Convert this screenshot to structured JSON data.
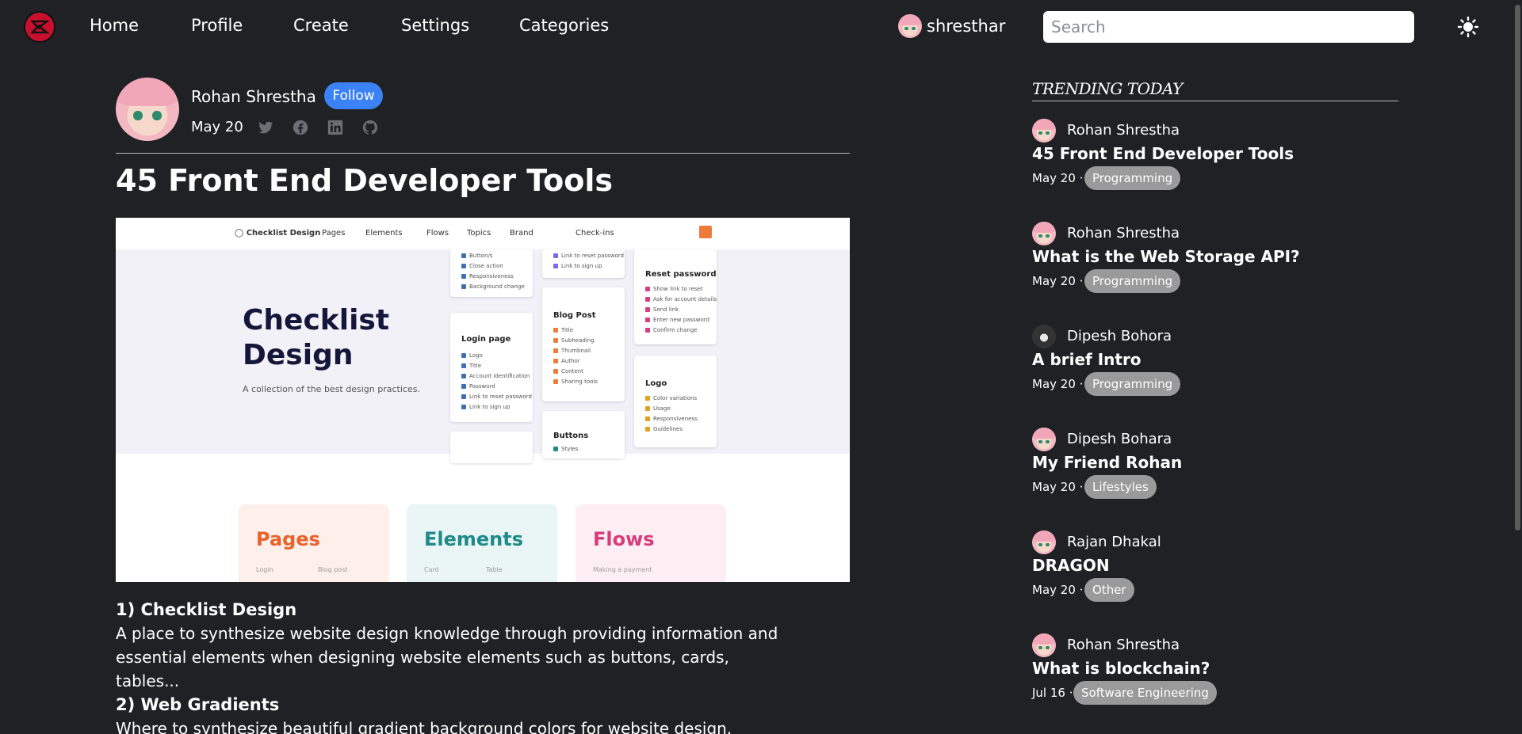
{
  "nav": {
    "links": [
      "Home",
      "Profile",
      "Create",
      "Settings",
      "Categories"
    ],
    "username": "shresthar",
    "search_placeholder": "Search"
  },
  "article": {
    "author": "Rohan Shrestha",
    "follow_label": "Follow",
    "date": "May 20",
    "title": "45 Front End Developer Tools",
    "hero": {
      "brand": "Checklist Design",
      "menu": [
        "Pages",
        "Elements",
        "Flows",
        "Topics",
        "Brand",
        "Check-ins"
      ],
      "headline": "Checklist Design",
      "subline": "A collection of the best design practices.",
      "cards": {
        "top_left": [
          "Button/s",
          "Close action",
          "Responsiveness",
          "Background change"
        ],
        "top_mid": [
          "Link to reset password",
          "Link to sign up"
        ],
        "login_title": "Login page",
        "login_items": [
          "Logo",
          "Title",
          "Account identification",
          "Password",
          "Link to reset password",
          "Link to sign up"
        ],
        "blog_title": "Blog Post",
        "blog_items": [
          "Title",
          "Subheading",
          "Thumbnail",
          "Author",
          "Content",
          "Sharing tools"
        ],
        "reset_title": "Reset password",
        "reset_items": [
          "Show link to reset",
          "Ask for account details",
          "Send link",
          "Enter new password",
          "Confirm change"
        ],
        "logo_title": "Logo",
        "logo_items": [
          "Color variations",
          "Usage",
          "Responsiveness",
          "Guidelines"
        ],
        "buttons_title": "Buttons",
        "buttons_items": [
          "Styles"
        ]
      },
      "big_cards": [
        {
          "title": "Pages",
          "a": "Login",
          "b": "Blog post",
          "color": "#e8622c",
          "bg": "#fdf0ea"
        },
        {
          "title": "Elements",
          "a": "Card",
          "b": "Table",
          "color": "#1f8a8a",
          "bg": "#eaf6f5"
        },
        {
          "title": "Flows",
          "a": "Making a payment",
          "b": "",
          "color": "#d63d7a",
          "bg": "#fdeef4"
        }
      ]
    },
    "sections": [
      {
        "heading": "1) Checklist Design",
        "body": "A place to synthesize website design knowledge through providing information and essential elements when designing website elements such as buttons, cards, tables..."
      },
      {
        "heading": "2) Web Gradients",
        "body": "Where to synthesize beautiful gradient background colors for website design."
      }
    ]
  },
  "sidebar": {
    "heading": "TRENDING TODAY",
    "items": [
      {
        "author": "Rohan Shrestha",
        "title": "45 Front End Developer Tools",
        "date": "May 20 ·",
        "tag": "Programming"
      },
      {
        "author": "Rohan Shrestha",
        "title": "What is the Web Storage API?",
        "date": "May 20 ·",
        "tag": "Programming"
      },
      {
        "author": "Dipesh Bohora",
        "title": "A brief Intro",
        "date": "May 20 ·",
        "tag": "Programming"
      },
      {
        "author": "Dipesh Bohara",
        "title": "My Friend Rohan",
        "date": "May 20 ·",
        "tag": "Lifestyles"
      },
      {
        "author": "Rajan Dhakal",
        "title": "DRAGON",
        "date": "May 20 ·",
        "tag": "Other"
      },
      {
        "author": "Rohan Shrestha",
        "title": "What is blockchain?",
        "date": "Jul 16 ·",
        "tag": "Software Engineering"
      }
    ]
  },
  "colors": {
    "background": "#202124",
    "accent": "#3b82f6",
    "tag": "#9a9a9a"
  }
}
